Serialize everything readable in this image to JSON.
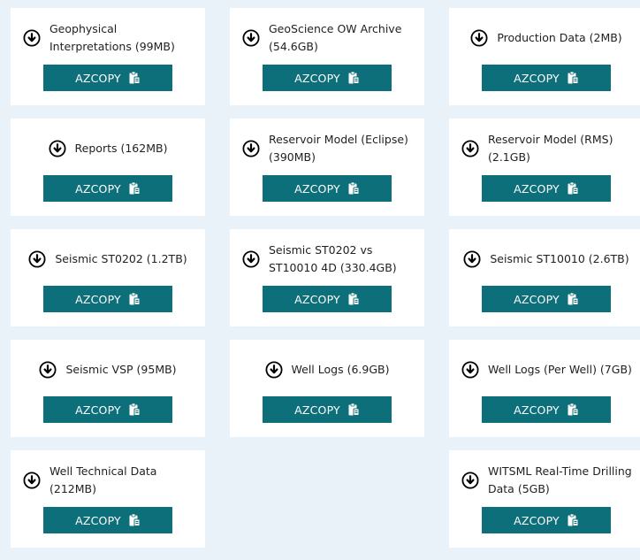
{
  "button_label": "AZCOPY",
  "accent_color": "#0d6f7a",
  "icons": {
    "download": "download-circle-icon",
    "copy": "clipboard-copy-icon"
  },
  "cards": [
    {
      "title": "Geophysical Interpretations (99MB)",
      "empty": false,
      "centered": false
    },
    {
      "title": "GeoScience OW Archive (54.6GB)",
      "empty": false,
      "centered": false
    },
    {
      "title": "Production Data (2MB)",
      "empty": false,
      "centered": true
    },
    {
      "title": "Reports (162MB)",
      "empty": false,
      "centered": true
    },
    {
      "title": "Reservoir Model (Eclipse) (390MB)",
      "empty": false,
      "centered": false
    },
    {
      "title": "Reservoir Model (RMS) (2.1GB)",
      "empty": false,
      "centered": false
    },
    {
      "title": "Seismic ST0202 (1.2TB)",
      "empty": false,
      "centered": true
    },
    {
      "title": "Seismic ST0202 vs ST10010 4D (330.4GB)",
      "empty": false,
      "centered": false
    },
    {
      "title": "Seismic ST10010 (2.6TB)",
      "empty": false,
      "centered": true
    },
    {
      "title": "Seismic VSP (95MB)",
      "empty": false,
      "centered": true
    },
    {
      "title": "Well Logs (6.9GB)",
      "empty": false,
      "centered": true
    },
    {
      "title": "Well Logs (Per Well) (7GB)",
      "empty": false,
      "centered": false
    },
    {
      "title": "Well Technical Data (212MB)",
      "empty": false,
      "centered": false
    },
    {
      "title": "",
      "empty": true,
      "centered": false
    },
    {
      "title": "WITSML Real-Time Drilling Data (5GB)",
      "empty": false,
      "centered": false
    }
  ]
}
